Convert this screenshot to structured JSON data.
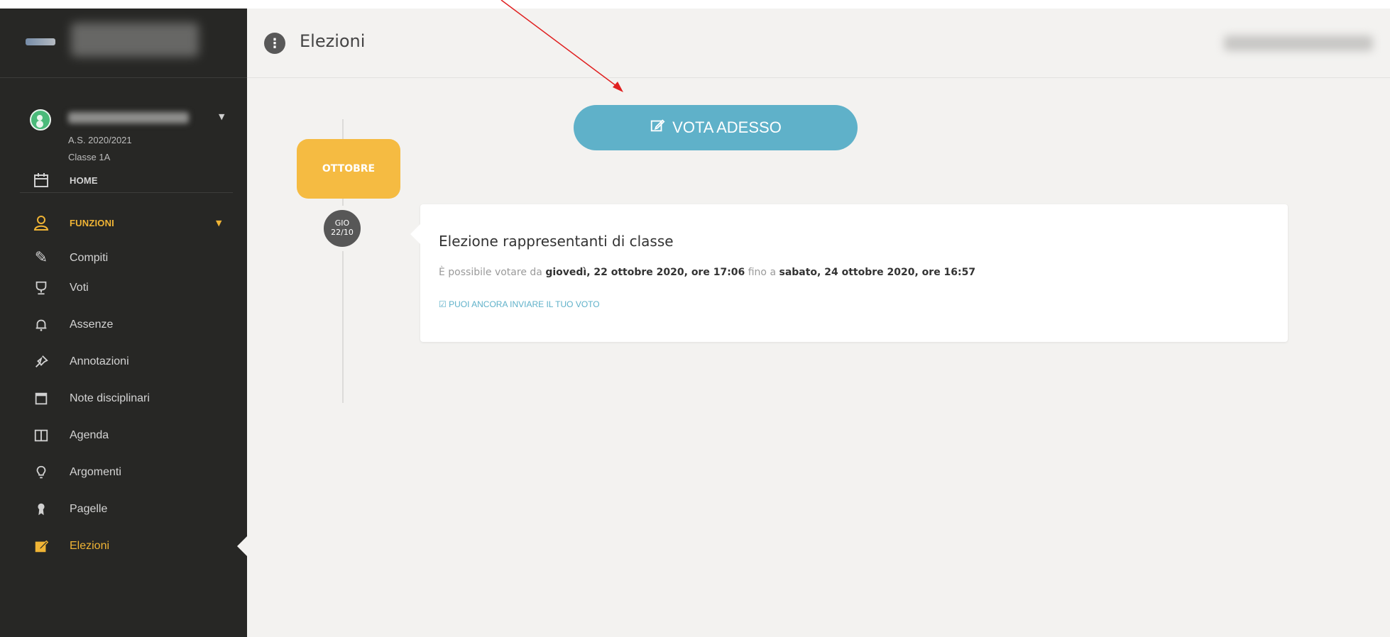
{
  "sidebar": {
    "user": {
      "school_year": "A.S. 2020/2021",
      "class": "Classe 1A"
    },
    "menu": {
      "home": "HOME",
      "funzioni": "FUNZIONI",
      "compiti": "Compiti",
      "voti": "Voti",
      "assenze": "Assenze",
      "annotazioni": "Annotazioni",
      "note_disciplinari": "Note disciplinari",
      "agenda": "Agenda",
      "argomenti": "Argomenti",
      "pagelle": "Pagelle",
      "elezioni": "Elezioni"
    }
  },
  "header": {
    "title": "Elezioni"
  },
  "main": {
    "vote_button": "VOTA ADESSO",
    "month": "OTTOBRE",
    "date_day": "GIO",
    "date_num": "22/10",
    "card": {
      "title": "Elezione rappresentanti di classe",
      "text_prefix": "È possibile votare da",
      "start": "giovedì, 22 ottobre 2020, ore 17:06",
      "text_middle": "fino a",
      "end": "sabato, 24 ottobre 2020, ore 16:57",
      "link": "PUOI ANCORA INVIARE IL TUO VOTO"
    }
  },
  "colors": {
    "sidebar_bg": "#272725",
    "accent_orange": "#f0b435",
    "button_blue": "#5fb1c9",
    "main_bg": "#f3f2f0"
  }
}
